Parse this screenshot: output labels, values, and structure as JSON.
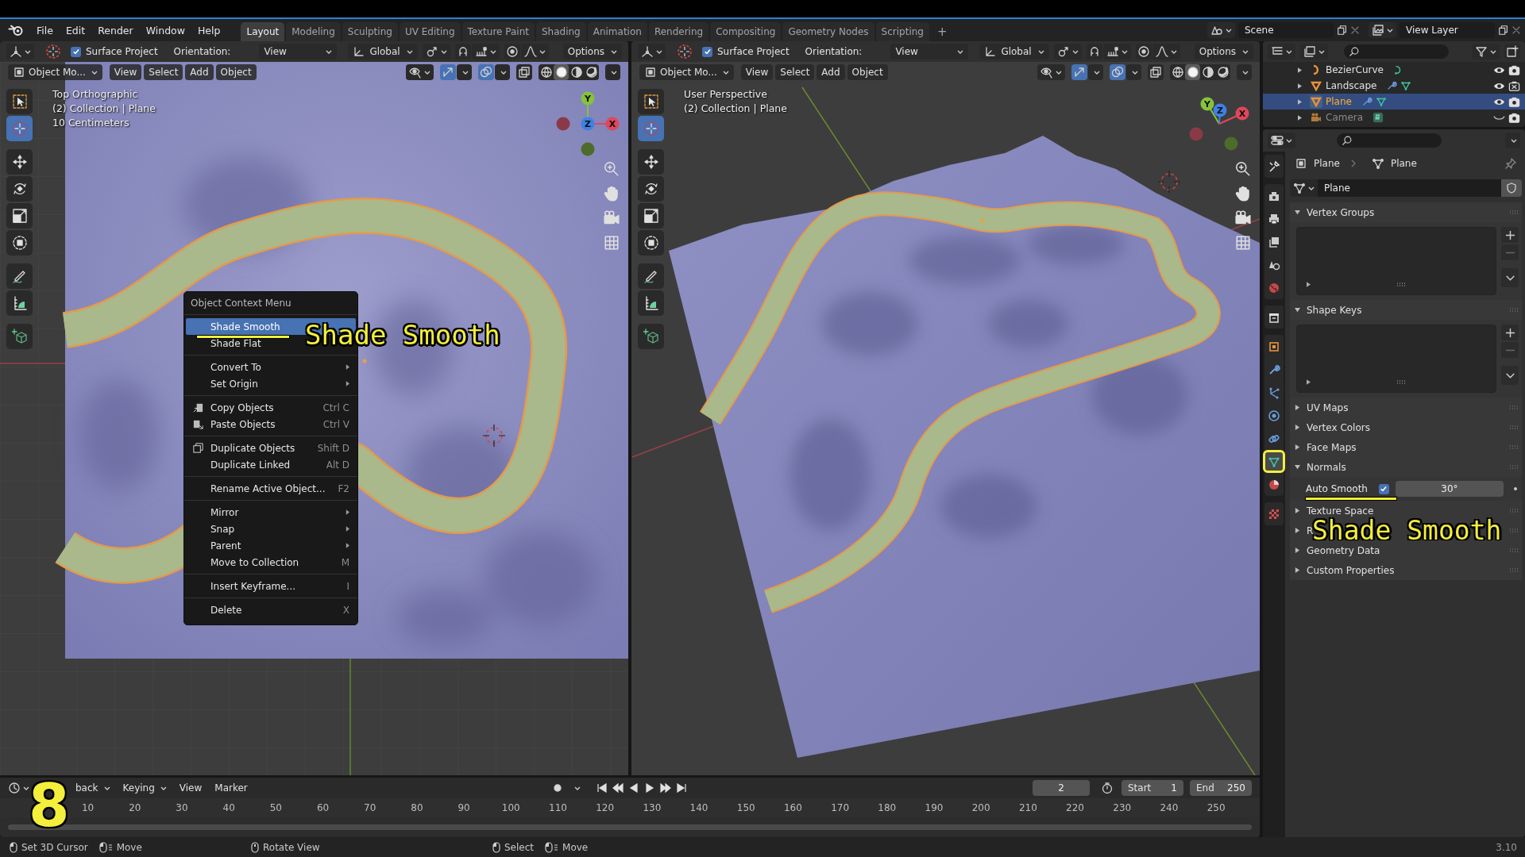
{
  "top_bar": {
    "menus": [
      "File",
      "Edit",
      "Render",
      "Window",
      "Help"
    ],
    "workspaces": [
      {
        "label": "Layout",
        "selected": true
      },
      {
        "label": "Modeling",
        "selected": false
      },
      {
        "label": "Sculpting",
        "selected": false
      },
      {
        "label": "UV Editing",
        "selected": false
      },
      {
        "label": "Texture Paint",
        "selected": false
      },
      {
        "label": "Shading",
        "selected": false
      },
      {
        "label": "Animation",
        "selected": false
      },
      {
        "label": "Rendering",
        "selected": false
      },
      {
        "label": "Compositing",
        "selected": false
      },
      {
        "label": "Geometry Nodes",
        "selected": false
      },
      {
        "label": "Scripting",
        "selected": false
      }
    ],
    "add_workspace": "+",
    "scene": "Scene",
    "view_layer": "View Layer"
  },
  "viewports": [
    {
      "kind": "ortho",
      "tool_settings": {
        "surface_project": {
          "label": "Surface Project",
          "checked": true
        },
        "orientation_label": "Orientation:",
        "orientation": "View",
        "transform": "Global",
        "options": "Options"
      },
      "header": {
        "mode": "Object Mo...",
        "menus": [
          "View",
          "Select",
          "Add",
          "Object"
        ],
        "toggles": [
          {
            "kind": "gizmo",
            "on": true
          },
          {
            "kind": "overlay",
            "on": true
          }
        ],
        "shading": [
          {
            "kind": "wireframe",
            "selected": false
          },
          {
            "kind": "solid",
            "selected": true
          },
          {
            "kind": "material",
            "selected": false
          },
          {
            "kind": "rendered",
            "selected": false
          }
        ]
      },
      "tools": [
        {
          "kind": "select",
          "selected": false
        },
        {
          "kind": "cursor",
          "selected": true
        },
        {
          "kind": "move",
          "selected": false
        },
        {
          "kind": "rotate",
          "selected": false
        },
        {
          "kind": "scale",
          "selected": false
        },
        {
          "kind": "transform",
          "selected": false
        },
        {
          "kind": "annotate",
          "selected": false
        },
        {
          "kind": "measure",
          "selected": false
        },
        {
          "kind": "add-cube",
          "selected": false
        }
      ],
      "info": [
        "Top Orthographic",
        "(2) Collection | Plane",
        "10 Centimeters"
      ],
      "gizmo": {
        "x": "X",
        "y": "Y",
        "z": "Z"
      },
      "context_menu": {
        "title": "Object Context Menu",
        "sections": [
          [
            {
              "label": "Shade Smooth",
              "kind": "plain",
              "selected": true,
              "submenu": false,
              "annotation": {
                "text": "Shade Smooth",
                "underline": true
              }
            },
            {
              "label": "Shade Flat",
              "kind": "plain",
              "selected": false,
              "submenu": false
            }
          ],
          [
            {
              "label": "Convert To",
              "kind": "plain",
              "selected": false,
              "submenu": true
            },
            {
              "label": "Set Origin",
              "kind": "plain",
              "selected": false,
              "submenu": true
            }
          ],
          [
            {
              "label": "Copy Objects",
              "kind": "copy",
              "selected": false,
              "submenu": false,
              "shortcut": "Ctrl C"
            },
            {
              "label": "Paste Objects",
              "kind": "paste",
              "selected": false,
              "submenu": false,
              "shortcut": "Ctrl V"
            }
          ],
          [
            {
              "label": "Duplicate Objects",
              "kind": "duplicate",
              "selected": false,
              "submenu": false,
              "shortcut": "Shift D"
            },
            {
              "label": "Duplicate Linked",
              "kind": "plain",
              "selected": false,
              "submenu": false,
              "shortcut": "Alt D"
            }
          ],
          [
            {
              "label": "Rename Active Object...",
              "kind": "plain",
              "selected": false,
              "submenu": false,
              "shortcut": "F2"
            }
          ],
          [
            {
              "label": "Mirror",
              "kind": "plain",
              "selected": false,
              "submenu": true
            },
            {
              "label": "Snap",
              "kind": "plain",
              "selected": false,
              "submenu": true
            },
            {
              "label": "Parent",
              "kind": "plain",
              "selected": false,
              "submenu": true
            },
            {
              "label": "Move to Collection",
              "kind": "plain",
              "selected": false,
              "submenu": false,
              "shortcut": "M"
            }
          ],
          [
            {
              "label": "Insert Keyframe...",
              "kind": "plain",
              "selected": false,
              "submenu": false,
              "shortcut": "I"
            }
          ],
          [
            {
              "label": "Delete",
              "kind": "plain",
              "selected": false,
              "submenu": false,
              "shortcut": "X"
            }
          ]
        ]
      }
    },
    {
      "kind": "perspective",
      "tool_settings": {
        "surface_project": {
          "label": "Surface Project",
          "checked": true
        },
        "orientation_label": "Orientation:",
        "orientation": "View",
        "transform": "Global",
        "options": "Options"
      },
      "header": {
        "mode": "Object Mo...",
        "menus": [
          "View",
          "Select",
          "Add",
          "Object"
        ],
        "toggles": [
          {
            "kind": "gizmo",
            "on": true
          },
          {
            "kind": "overlay",
            "on": true
          }
        ],
        "shading": [
          {
            "kind": "wireframe",
            "selected": false
          },
          {
            "kind": "solid",
            "selected": true
          },
          {
            "kind": "material",
            "selected": false
          },
          {
            "kind": "rendered",
            "selected": false
          }
        ]
      },
      "tools": [
        {
          "kind": "select",
          "selected": false
        },
        {
          "kind": "cursor",
          "selected": true
        },
        {
          "kind": "move",
          "selected": false
        },
        {
          "kind": "rotate",
          "selected": false
        },
        {
          "kind": "scale",
          "selected": false
        },
        {
          "kind": "transform",
          "selected": false
        },
        {
          "kind": "annotate",
          "selected": false
        },
        {
          "kind": "measure",
          "selected": false
        },
        {
          "kind": "add-cube",
          "selected": false
        }
      ],
      "info": [
        "User Perspective",
        "(2) Collection | Plane"
      ],
      "gizmo": {
        "x": "X",
        "y": "Y",
        "z": "Z"
      }
    }
  ],
  "timeline": {
    "menus": [
      {
        "label": "back",
        "dropdown": true
      },
      {
        "label": "Keying",
        "dropdown": true
      },
      {
        "label": "View",
        "dropdown": false
      },
      {
        "label": "Marker",
        "dropdown": false
      }
    ],
    "current_frame": "2",
    "start_label": "Start",
    "start": "1",
    "end_label": "End",
    "end": "250",
    "ticks": [
      "10",
      "20",
      "30",
      "40",
      "50",
      "60",
      "70",
      "80",
      "90",
      "100",
      "110",
      "120",
      "130",
      "140",
      "150",
      "160",
      "170",
      "180",
      "190",
      "200",
      "210",
      "220",
      "230",
      "240",
      "250"
    ],
    "annotation": "8"
  },
  "outliner": {
    "items": [
      {
        "name": "BezierCurve",
        "kind": "curve",
        "selected": false,
        "visible": true,
        "renderable": true
      },
      {
        "name": "Landscape",
        "kind": "mesh",
        "selected": false,
        "visible": true,
        "renderable": false
      },
      {
        "name": "Plane",
        "kind": "mesh",
        "selected": true,
        "visible": true,
        "renderable": true
      },
      {
        "name": "Camera",
        "kind": "camera",
        "selected": false,
        "visible": false,
        "renderable": true
      }
    ]
  },
  "properties": {
    "tab_groups": [
      [
        {
          "kind": "tool",
          "selected": false,
          "framed": false
        }
      ],
      [
        {
          "kind": "render",
          "selected": false,
          "framed": false
        },
        {
          "kind": "output",
          "selected": false,
          "framed": false
        },
        {
          "kind": "view-layer",
          "selected": false,
          "framed": false
        },
        {
          "kind": "scene",
          "selected": false,
          "framed": false
        },
        {
          "kind": "world",
          "selected": false,
          "framed": false
        }
      ],
      [
        {
          "kind": "collection",
          "selected": false,
          "framed": false
        }
      ],
      [
        {
          "kind": "object",
          "selected": false,
          "framed": false
        },
        {
          "kind": "modifier",
          "selected": false,
          "framed": false
        },
        {
          "kind": "particles",
          "selected": false,
          "framed": false
        },
        {
          "kind": "physics",
          "selected": false,
          "framed": false
        },
        {
          "kind": "constraints",
          "selected": false,
          "framed": false
        },
        {
          "kind": "data",
          "selected": true,
          "framed": true
        },
        {
          "kind": "material",
          "selected": false,
          "framed": false
        }
      ],
      [
        {
          "kind": "texture",
          "selected": false,
          "framed": false
        }
      ]
    ],
    "breadcrumb": [
      {
        "kind": "object",
        "label": "Plane"
      },
      {
        "kind": "mesh",
        "label": "Plane"
      }
    ],
    "data_block": "Plane",
    "panels": [
      {
        "title": "Vertex Groups",
        "kind": "list",
        "expanded": true
      },
      {
        "title": "Shape Keys",
        "kind": "list",
        "expanded": true
      },
      {
        "title": "UV Maps",
        "kind": "plain",
        "expanded": false
      },
      {
        "title": "Vertex Colors",
        "kind": "plain",
        "expanded": false
      },
      {
        "title": "Face Maps",
        "kind": "plain",
        "expanded": false
      },
      {
        "title": "Normals",
        "kind": "normals",
        "expanded": true,
        "auto_smooth": {
          "label": "Auto Smooth",
          "checked": true,
          "angle": "30°",
          "underline": true
        }
      },
      {
        "title": "Texture Space",
        "kind": "plain",
        "expanded": false
      },
      {
        "title": "R",
        "kind": "plain",
        "expanded": false,
        "annotation": "Shade Smooth"
      },
      {
        "title": "Geometry Data",
        "kind": "plain",
        "expanded": false
      },
      {
        "title": "Custom Properties",
        "kind": "plain",
        "expanded": false
      }
    ]
  },
  "status_bar": {
    "groups": [
      [
        {
          "kind": "left-click",
          "label": "Set 3D Cursor"
        },
        {
          "kind": "drag",
          "label": "Move"
        }
      ],
      [
        {
          "kind": "middle-click",
          "label": "Rotate View"
        }
      ],
      [
        {
          "kind": "left-click",
          "label": "Select"
        },
        {
          "kind": "drag",
          "label": "Move"
        }
      ]
    ],
    "version": "3.10"
  }
}
